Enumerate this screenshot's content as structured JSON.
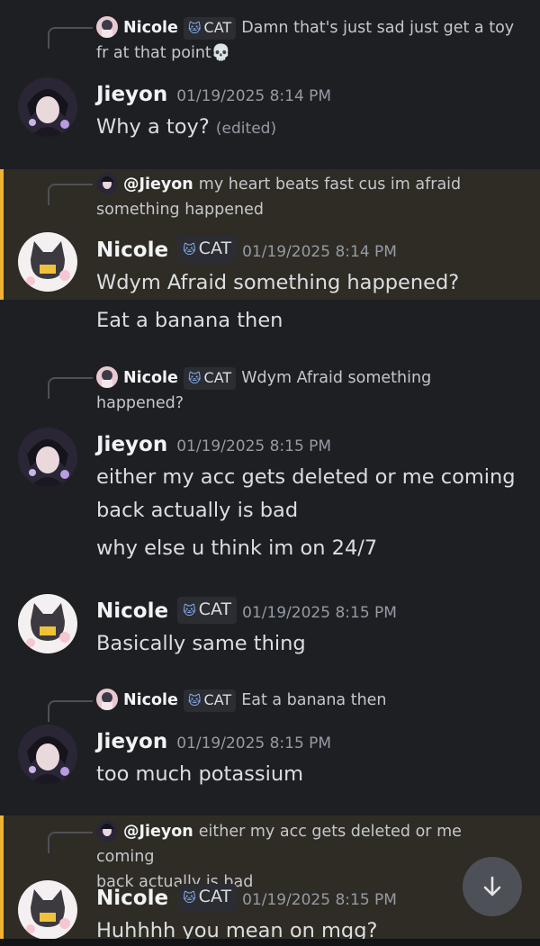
{
  "messages": [
    {
      "reply": {
        "prefix": "",
        "name": "Nicole",
        "tag": "CAT",
        "text": "Damn that's just sad just get a toy",
        "text2": "fr at that point💀"
      },
      "author": "Jieyon",
      "timestamp": "01/19/2025 8:14 PM",
      "lines": [
        "Why a toy?"
      ],
      "edited": "(edited)"
    },
    {
      "reply": {
        "mention": "@Jieyon",
        "text": "my heart beats fast cus im afraid",
        "text2": "something happened"
      },
      "author": "Nicole",
      "tag": "CAT",
      "timestamp": "01/19/2025 8:14 PM",
      "lines": [
        "Wdym Afraid something happened?",
        "Eat a banana then"
      ]
    },
    {
      "reply": {
        "name": "Nicole",
        "tag": "CAT",
        "text": "Wdym Afraid something",
        "text2": "happened?"
      },
      "author": "Jieyon",
      "timestamp": "01/19/2025 8:15 PM",
      "lines": [
        "either my acc gets deleted or me coming",
        "back actually is bad",
        "why else u think im on 24/7"
      ]
    },
    {
      "author": "Nicole",
      "tag": "CAT",
      "timestamp": "01/19/2025 8:15 PM",
      "lines": [
        "Basically same thing"
      ]
    },
    {
      "reply": {
        "name": "Nicole",
        "tag": "CAT",
        "text": "Eat a banana then"
      },
      "author": "Jieyon",
      "timestamp": "01/19/2025 8:15 PM",
      "lines": [
        "too much potassium"
      ]
    },
    {
      "reply": {
        "mention": "@Jieyon",
        "text": "either my acc gets deleted or me coming",
        "text2": "back actually is bad"
      },
      "author": "Nicole",
      "tag": "CAT",
      "timestamp": "01/19/2025 8:15 PM",
      "lines": [
        "Huhhhh you mean on mgg?"
      ]
    }
  ],
  "icons": {
    "scroll_down": "arrow-down-icon",
    "role_tag": "cat-icon"
  },
  "colors": {
    "background": "#1e1f23",
    "mention_highlight": "#2f2c25",
    "mention_bar": "#f0b232",
    "timestamp": "#949ba4"
  }
}
